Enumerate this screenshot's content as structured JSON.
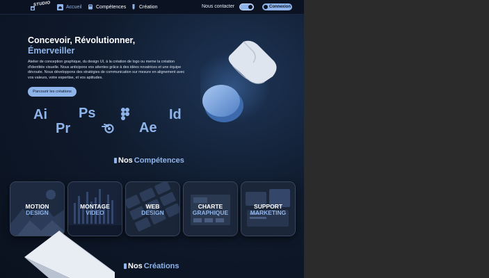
{
  "nav": {
    "logo_text": "STUDIO",
    "items": [
      {
        "label": "Accueil",
        "icon": "home-icon",
        "active": true
      },
      {
        "label": "Compétences",
        "icon": "book-icon",
        "active": false
      },
      {
        "label": "Création",
        "icon": "pen-icon",
        "active": false
      }
    ],
    "contact": "Nous contacter",
    "login": "Connexion"
  },
  "hero": {
    "title_line1": "Concevoir, Révolutionner,",
    "title_line2": "Émerveiller",
    "description": "Atelier de conception graphique, du design UI, à la création de logo ou meme la création d'identitée visuelle. Nous anticipons vos attentes grâce à des idées novatrices et une équipe dévouée. Nous développons des stratégies de communication sur mesure en alignement avec vos valeurs, votre expertise, et vos aptitudes.",
    "cta": "Parcourir les créations"
  },
  "software": [
    {
      "label": "Ai",
      "name": "illustrator-logo"
    },
    {
      "label": "Pr",
      "name": "premiere-logo"
    },
    {
      "label": "Ps",
      "name": "photoshop-logo"
    },
    {
      "label": "",
      "name": "blender-icon"
    },
    {
      "label": "",
      "name": "figma-icon"
    },
    {
      "label": "Ae",
      "name": "after-effects-logo"
    },
    {
      "label": "Id",
      "name": "indesign-logo"
    }
  ],
  "competences": {
    "title_a": "Nos",
    "title_b": "Compétences",
    "cards": [
      {
        "line1": "MOTION",
        "line2": "DESIGN"
      },
      {
        "line1": "MONTAGE",
        "line2": "VIDEO"
      },
      {
        "line1": "WEB",
        "line2": "DESIGN"
      },
      {
        "line1": "CHARTE",
        "line2": "GRAPHIQUE"
      },
      {
        "line1": "SUPPORT",
        "line2": "MARKETING"
      }
    ]
  },
  "creations": {
    "title_a": "Nos",
    "title_b": "Créations"
  },
  "colors": {
    "accent": "#8fb4ea",
    "background": "#0f1a2c",
    "outside": "#2b2b2b"
  }
}
